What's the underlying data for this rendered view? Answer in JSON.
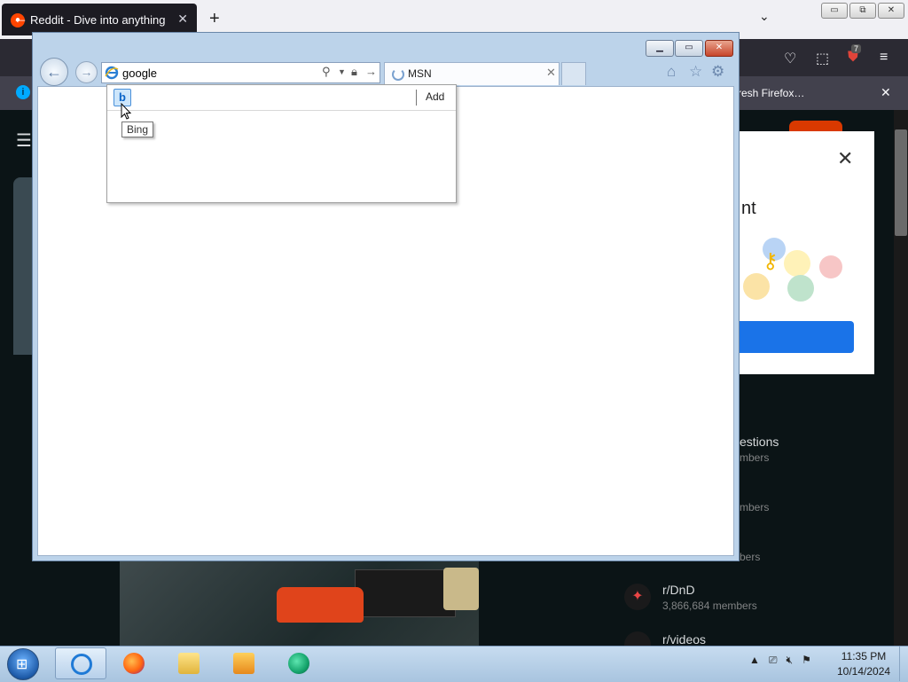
{
  "firefox": {
    "tab_title": "Reddit - Dive into anything",
    "tab_close": "✕",
    "new_tab": "+",
    "tab_list": "⌄",
    "window_buttons": [
      "▭",
      "⧉",
      "✕"
    ],
    "notice_text": "resh Firefox…",
    "notice_close": "✕",
    "extension_badge": "7"
  },
  "reddit": {
    "modal_title_fragment": "nt",
    "modal_close": "✕",
    "sidebar_communities": [
      {
        "name": "estions",
        "members": "mbers"
      },
      {
        "name": "",
        "members": "mbers"
      },
      {
        "name": "",
        "members": "bers"
      },
      {
        "name": "r/DnD",
        "members": "3,866,684 members"
      },
      {
        "name": "r/videos",
        "members": ""
      }
    ]
  },
  "ie": {
    "caption_buttons": {
      "minimize": "▁",
      "restore": "▭",
      "close": "✕"
    },
    "address_value": "google",
    "tab_label": "MSN",
    "tab_close": "✕",
    "dropdown": {
      "add_label": "Add",
      "provider_tooltip": "Bing"
    }
  },
  "taskbar": {
    "time": "11:35 PM",
    "date": "10/14/2024"
  },
  "colors": {
    "reddit_orange": "#ff4500",
    "modal_button": "#1a73e8",
    "ie_frame": "#bcd3ea"
  }
}
